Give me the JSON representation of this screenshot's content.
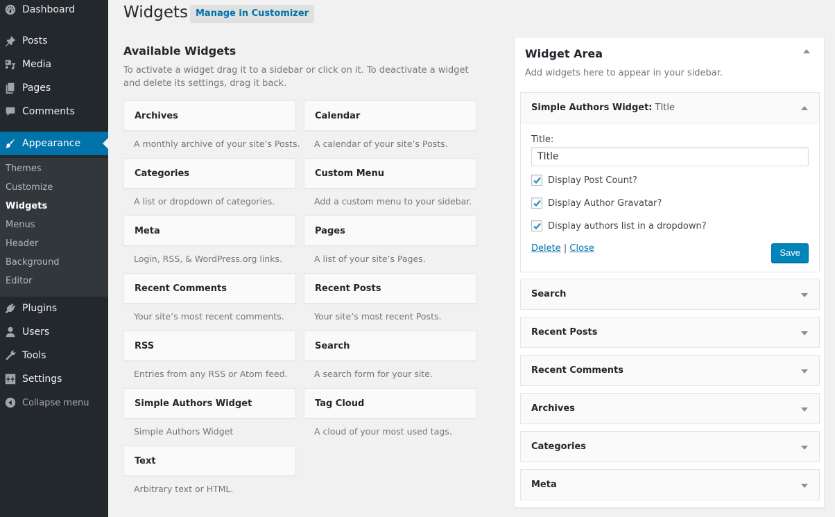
{
  "sidebar": {
    "items": [
      {
        "label": "Dashboard",
        "icon": "dashboard-icon"
      },
      {
        "label": "Posts",
        "icon": "pin-icon"
      },
      {
        "label": "Media",
        "icon": "media-icon"
      },
      {
        "label": "Pages",
        "icon": "pages-icon"
      },
      {
        "label": "Comments",
        "icon": "comment-icon"
      },
      {
        "label": "Appearance",
        "icon": "paintbrush-icon",
        "current": true
      },
      {
        "label": "Plugins",
        "icon": "plug-icon"
      },
      {
        "label": "Users",
        "icon": "user-icon"
      },
      {
        "label": "Tools",
        "icon": "wrench-icon"
      },
      {
        "label": "Settings",
        "icon": "settings-icon"
      }
    ],
    "submenu": [
      {
        "label": "Themes"
      },
      {
        "label": "Customize"
      },
      {
        "label": "Widgets",
        "current": true
      },
      {
        "label": "Menus"
      },
      {
        "label": "Header"
      },
      {
        "label": "Background"
      },
      {
        "label": "Editor"
      }
    ],
    "collapse_label": "Collapse menu"
  },
  "header": {
    "title": "Widgets",
    "action_label": "Manage in Customizer"
  },
  "available": {
    "title": "Available Widgets",
    "description": "To activate a widget drag it to a sidebar or click on it. To deactivate a widget and delete its settings, drag it back.",
    "widgets": [
      {
        "name": "Archives",
        "desc": "A monthly archive of your site’s Posts."
      },
      {
        "name": "Calendar",
        "desc": "A calendar of your site’s Posts."
      },
      {
        "name": "Categories",
        "desc": "A list or dropdown of categories."
      },
      {
        "name": "Custom Menu",
        "desc": "Add a custom menu to your sidebar."
      },
      {
        "name": "Meta",
        "desc": "Login, RSS, & WordPress.org links."
      },
      {
        "name": "Pages",
        "desc": "A list of your site’s Pages."
      },
      {
        "name": "Recent Comments",
        "desc": "Your site’s most recent comments."
      },
      {
        "name": "Recent Posts",
        "desc": "Your site’s most recent Posts."
      },
      {
        "name": "RSS",
        "desc": "Entries from any RSS or Atom feed."
      },
      {
        "name": "Search",
        "desc": "A search form for your site."
      },
      {
        "name": "Simple Authors Widget",
        "desc": "Simple Authors Widget"
      },
      {
        "name": "Tag Cloud",
        "desc": "A cloud of your most used tags."
      },
      {
        "name": "Text",
        "desc": "Arbitrary text or HTML."
      }
    ]
  },
  "widget_area": {
    "title": "Widget Area",
    "description": "Add widgets here to appear in your sidebar.",
    "open_widget": {
      "name": "Simple Authors Widget:",
      "instance_title": "TItle",
      "title_label": "Title:",
      "title_value": "TItle",
      "checkboxes": [
        {
          "label": "Display Post Count?",
          "checked": true
        },
        {
          "label": "Display Author Gravatar?",
          "checked": true
        },
        {
          "label": "Display authors list in a dropdown?",
          "checked": true
        }
      ],
      "delete_label": "Delete",
      "separator": "|",
      "close_label": "Close",
      "save_label": "Save"
    },
    "widgets": [
      {
        "name": "Search"
      },
      {
        "name": "Recent Posts"
      },
      {
        "name": "Recent Comments"
      },
      {
        "name": "Archives"
      },
      {
        "name": "Categories"
      },
      {
        "name": "Meta"
      }
    ]
  },
  "colors": {
    "menu_bg": "#23282d",
    "submenu_bg": "#32373c",
    "accent": "#0073aa",
    "button_primary": "#0085ba",
    "page_bg": "#f1f1f1"
  }
}
